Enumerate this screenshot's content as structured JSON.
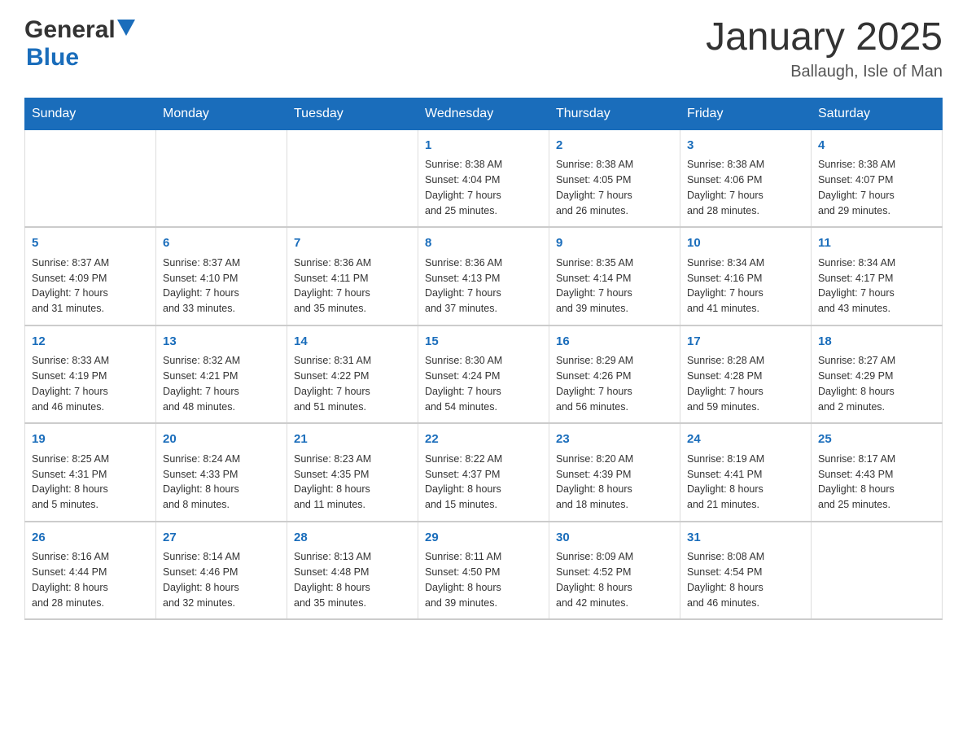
{
  "header": {
    "logo": {
      "general": "General",
      "blue": "Blue"
    },
    "title": "January 2025",
    "subtitle": "Ballaugh, Isle of Man"
  },
  "days_of_week": [
    "Sunday",
    "Monday",
    "Tuesday",
    "Wednesday",
    "Thursday",
    "Friday",
    "Saturday"
  ],
  "weeks": [
    [
      {
        "day": "",
        "content": ""
      },
      {
        "day": "",
        "content": ""
      },
      {
        "day": "",
        "content": ""
      },
      {
        "day": "1",
        "content": "Sunrise: 8:38 AM\nSunset: 4:04 PM\nDaylight: 7 hours\nand 25 minutes."
      },
      {
        "day": "2",
        "content": "Sunrise: 8:38 AM\nSunset: 4:05 PM\nDaylight: 7 hours\nand 26 minutes."
      },
      {
        "day": "3",
        "content": "Sunrise: 8:38 AM\nSunset: 4:06 PM\nDaylight: 7 hours\nand 28 minutes."
      },
      {
        "day": "4",
        "content": "Sunrise: 8:38 AM\nSunset: 4:07 PM\nDaylight: 7 hours\nand 29 minutes."
      }
    ],
    [
      {
        "day": "5",
        "content": "Sunrise: 8:37 AM\nSunset: 4:09 PM\nDaylight: 7 hours\nand 31 minutes."
      },
      {
        "day": "6",
        "content": "Sunrise: 8:37 AM\nSunset: 4:10 PM\nDaylight: 7 hours\nand 33 minutes."
      },
      {
        "day": "7",
        "content": "Sunrise: 8:36 AM\nSunset: 4:11 PM\nDaylight: 7 hours\nand 35 minutes."
      },
      {
        "day": "8",
        "content": "Sunrise: 8:36 AM\nSunset: 4:13 PM\nDaylight: 7 hours\nand 37 minutes."
      },
      {
        "day": "9",
        "content": "Sunrise: 8:35 AM\nSunset: 4:14 PM\nDaylight: 7 hours\nand 39 minutes."
      },
      {
        "day": "10",
        "content": "Sunrise: 8:34 AM\nSunset: 4:16 PM\nDaylight: 7 hours\nand 41 minutes."
      },
      {
        "day": "11",
        "content": "Sunrise: 8:34 AM\nSunset: 4:17 PM\nDaylight: 7 hours\nand 43 minutes."
      }
    ],
    [
      {
        "day": "12",
        "content": "Sunrise: 8:33 AM\nSunset: 4:19 PM\nDaylight: 7 hours\nand 46 minutes."
      },
      {
        "day": "13",
        "content": "Sunrise: 8:32 AM\nSunset: 4:21 PM\nDaylight: 7 hours\nand 48 minutes."
      },
      {
        "day": "14",
        "content": "Sunrise: 8:31 AM\nSunset: 4:22 PM\nDaylight: 7 hours\nand 51 minutes."
      },
      {
        "day": "15",
        "content": "Sunrise: 8:30 AM\nSunset: 4:24 PM\nDaylight: 7 hours\nand 54 minutes."
      },
      {
        "day": "16",
        "content": "Sunrise: 8:29 AM\nSunset: 4:26 PM\nDaylight: 7 hours\nand 56 minutes."
      },
      {
        "day": "17",
        "content": "Sunrise: 8:28 AM\nSunset: 4:28 PM\nDaylight: 7 hours\nand 59 minutes."
      },
      {
        "day": "18",
        "content": "Sunrise: 8:27 AM\nSunset: 4:29 PM\nDaylight: 8 hours\nand 2 minutes."
      }
    ],
    [
      {
        "day": "19",
        "content": "Sunrise: 8:25 AM\nSunset: 4:31 PM\nDaylight: 8 hours\nand 5 minutes."
      },
      {
        "day": "20",
        "content": "Sunrise: 8:24 AM\nSunset: 4:33 PM\nDaylight: 8 hours\nand 8 minutes."
      },
      {
        "day": "21",
        "content": "Sunrise: 8:23 AM\nSunset: 4:35 PM\nDaylight: 8 hours\nand 11 minutes."
      },
      {
        "day": "22",
        "content": "Sunrise: 8:22 AM\nSunset: 4:37 PM\nDaylight: 8 hours\nand 15 minutes."
      },
      {
        "day": "23",
        "content": "Sunrise: 8:20 AM\nSunset: 4:39 PM\nDaylight: 8 hours\nand 18 minutes."
      },
      {
        "day": "24",
        "content": "Sunrise: 8:19 AM\nSunset: 4:41 PM\nDaylight: 8 hours\nand 21 minutes."
      },
      {
        "day": "25",
        "content": "Sunrise: 8:17 AM\nSunset: 4:43 PM\nDaylight: 8 hours\nand 25 minutes."
      }
    ],
    [
      {
        "day": "26",
        "content": "Sunrise: 8:16 AM\nSunset: 4:44 PM\nDaylight: 8 hours\nand 28 minutes."
      },
      {
        "day": "27",
        "content": "Sunrise: 8:14 AM\nSunset: 4:46 PM\nDaylight: 8 hours\nand 32 minutes."
      },
      {
        "day": "28",
        "content": "Sunrise: 8:13 AM\nSunset: 4:48 PM\nDaylight: 8 hours\nand 35 minutes."
      },
      {
        "day": "29",
        "content": "Sunrise: 8:11 AM\nSunset: 4:50 PM\nDaylight: 8 hours\nand 39 minutes."
      },
      {
        "day": "30",
        "content": "Sunrise: 8:09 AM\nSunset: 4:52 PM\nDaylight: 8 hours\nand 42 minutes."
      },
      {
        "day": "31",
        "content": "Sunrise: 8:08 AM\nSunset: 4:54 PM\nDaylight: 8 hours\nand 46 minutes."
      },
      {
        "day": "",
        "content": ""
      }
    ]
  ]
}
